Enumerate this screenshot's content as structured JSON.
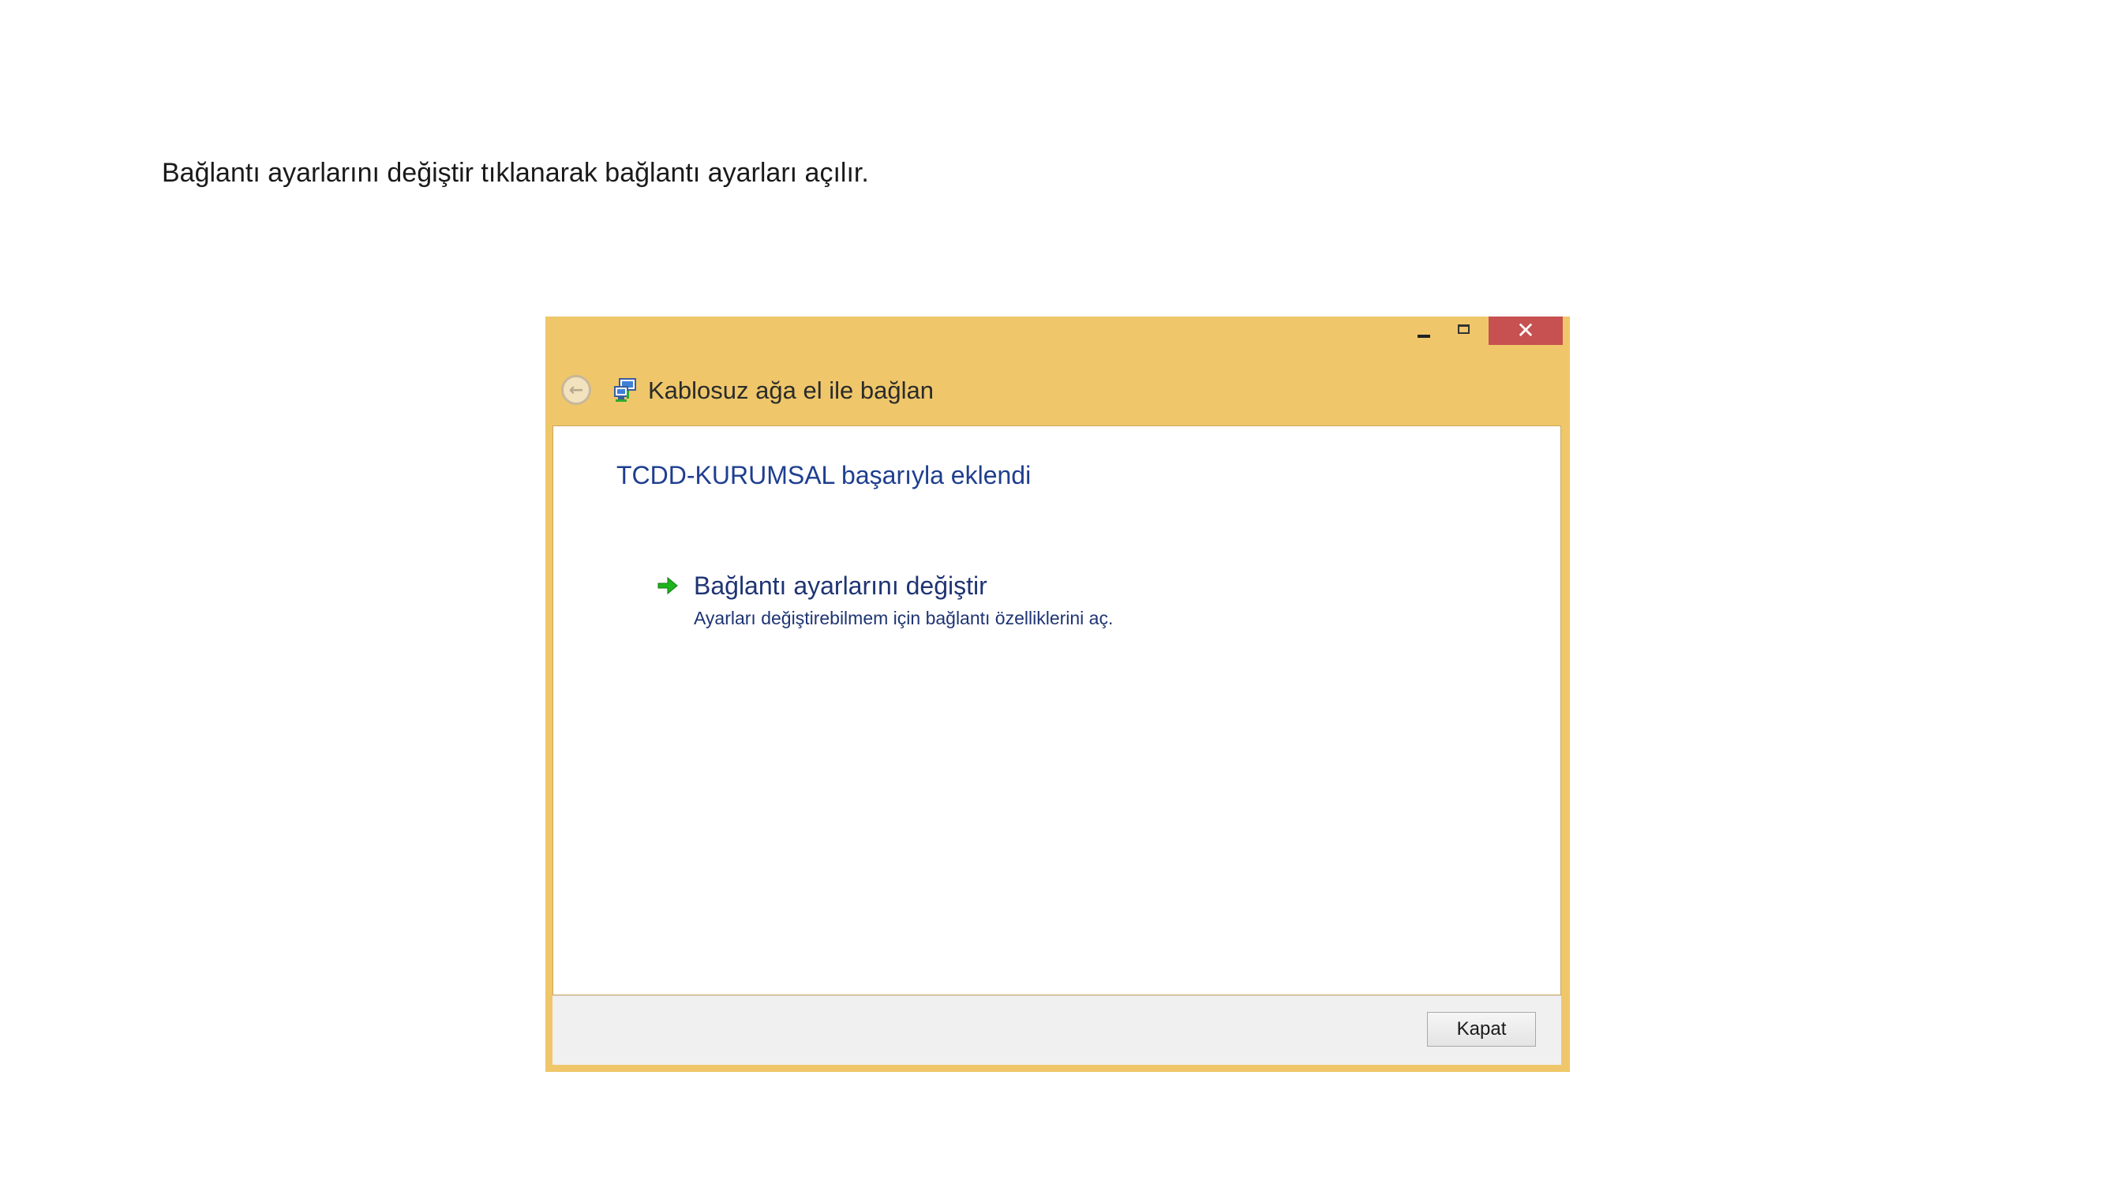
{
  "caption": "Bağlantı ayarlarını değiştir tıklanarak bağlantı ayarları açılır.",
  "window": {
    "controls": {
      "minimize_icon": "minimize-icon",
      "maximize_icon": "maximize-icon",
      "close_glyph": "✕"
    },
    "header": {
      "back_icon": "back-arrow-icon",
      "back_glyph": "←",
      "network_icon": "wireless-network-icon",
      "title": "Kablosuz ağa el ile bağlan"
    },
    "content": {
      "success_message": "TCDD-KURUMSAL başarıyla eklendi",
      "change_settings": {
        "icon": "green-arrow-icon",
        "title": "Bağlantı ayarlarını değiştir",
        "description": "Ayarları değiştirebilmem için bağlantı özelliklerini aç."
      }
    },
    "footer": {
      "close_button_label": "Kapat"
    }
  },
  "colors": {
    "window_frame": "#efc76a",
    "close_button_bg": "#c75050",
    "title_blue": "#1e3e8f",
    "link_blue": "#1e3473",
    "arrow_green": "#1db41d"
  }
}
